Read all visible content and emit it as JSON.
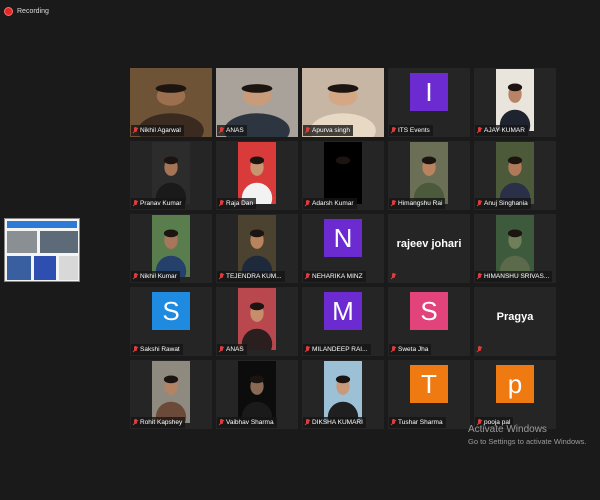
{
  "recording": {
    "label": "Recording"
  },
  "participants": [
    {
      "name": "Nikhil Agarwal",
      "mic_muted": true,
      "active_speaker": true,
      "kind": "video",
      "scene": {
        "bg": "#6f5336",
        "person": "#3a2a20",
        "skin": "#9c6f4f"
      }
    },
    {
      "name": "ANAS",
      "mic_muted": true,
      "kind": "video",
      "scene": {
        "bg": "#a9a29a",
        "person": "#2d3640",
        "skin": "#c89c7a"
      }
    },
    {
      "name": "Apurva singh",
      "mic_muted": true,
      "kind": "video",
      "scene": {
        "bg": "#c6b6a3",
        "person": "#e8d9c4",
        "skin": "#d4a884"
      }
    },
    {
      "name": "ITS Events",
      "mic_muted": true,
      "kind": "avatar",
      "initial": "I",
      "color": "#6b2bd1"
    },
    {
      "name": "AJAY KUMAR",
      "mic_muted": true,
      "kind": "photo",
      "scene": {
        "bg": "#e9e4dc",
        "person": "#1f2330",
        "skin": "#b98465"
      }
    },
    {
      "name": "Pranav Kumar",
      "mic_muted": true,
      "kind": "photo",
      "scene": {
        "bg": "#2c2c2c",
        "person": "#1a1a1a",
        "skin": "#a57456"
      }
    },
    {
      "name": "Raja Dan",
      "mic_muted": true,
      "kind": "photo",
      "scene": {
        "bg": "#d93a3a",
        "person": "#f2f2f2",
        "skin": "#c99470"
      }
    },
    {
      "name": "Adarsh Kumar",
      "mic_muted": true,
      "kind": "photo",
      "scene": {
        "bg": "#000000",
        "person": "#000000",
        "skin": "#000000"
      }
    },
    {
      "name": "Himangshu Rai",
      "mic_muted": true,
      "kind": "photo",
      "scene": {
        "bg": "#6a6f55",
        "person": "#4a5a3a",
        "skin": "#b8845f"
      }
    },
    {
      "name": "Anuj Singhania",
      "mic_muted": true,
      "kind": "photo",
      "scene": {
        "bg": "#4d5a3a",
        "person": "#2a3048",
        "skin": "#b07a5a"
      }
    },
    {
      "name": "Nikhil Kumar",
      "mic_muted": true,
      "kind": "photo",
      "scene": {
        "bg": "#5a7d4e",
        "person": "#25406b",
        "skin": "#a8765a"
      }
    },
    {
      "name": "TEJENDRA KUM...",
      "mic_muted": true,
      "kind": "photo",
      "scene": {
        "bg": "#4c4230",
        "person": "#1e2a3c",
        "skin": "#b8845e"
      }
    },
    {
      "name": "NEHARIKA MINZ",
      "mic_muted": true,
      "kind": "avatar",
      "initial": "N",
      "color": "#6b2bd1"
    },
    {
      "name": "rajeev johari",
      "mic_muted": true,
      "kind": "text"
    },
    {
      "name": "HIMANSHU SRIVAS...",
      "mic_muted": true,
      "kind": "photo",
      "scene": {
        "bg": "#3e5a3c",
        "person": "#5a6a4a",
        "skin": "#6f7f5a"
      }
    },
    {
      "name": "Sakshi Rawat",
      "mic_muted": true,
      "kind": "avatar",
      "initial": "S",
      "color": "#1e8be0"
    },
    {
      "name": "ANAS",
      "mic_muted": true,
      "kind": "photo",
      "scene": {
        "bg": "#b9484e",
        "person": "#2a1e1e",
        "skin": "#c88e6c"
      }
    },
    {
      "name": "MILANDEEP RAI...",
      "mic_muted": true,
      "kind": "avatar",
      "initial": "M",
      "color": "#6b2bd1"
    },
    {
      "name": "Sweta Jha",
      "mic_muted": true,
      "kind": "avatar",
      "initial": "S",
      "color": "#e2437a"
    },
    {
      "name": "Pragya",
      "mic_muted": true,
      "kind": "text"
    },
    {
      "name": "Rohit Kapshey",
      "mic_muted": true,
      "kind": "photo",
      "scene": {
        "bg": "#8e8a80",
        "person": "#6c4a3a",
        "skin": "#b38463"
      }
    },
    {
      "name": "Vaibhav Sharma",
      "mic_muted": true,
      "kind": "photo",
      "scene": {
        "bg": "#0c0c0c",
        "person": "#1a1a1a",
        "skin": "#8a6a55"
      }
    },
    {
      "name": "DIKSHA KUMARI",
      "mic_muted": true,
      "kind": "photo",
      "scene": {
        "bg": "#9cc0d6",
        "person": "#1f1f1f",
        "skin": "#c99a7a"
      }
    },
    {
      "name": "Tushar Sharma",
      "mic_muted": true,
      "kind": "avatar",
      "initial": "T",
      "color": "#ef7a12"
    },
    {
      "name": "pooja pal",
      "mic_muted": true,
      "kind": "avatar",
      "initial": "p",
      "color": "#ef7a12"
    }
  ],
  "windows_watermark": {
    "title": "Activate Windows",
    "subtitle": "Go to Settings to activate Windows."
  }
}
